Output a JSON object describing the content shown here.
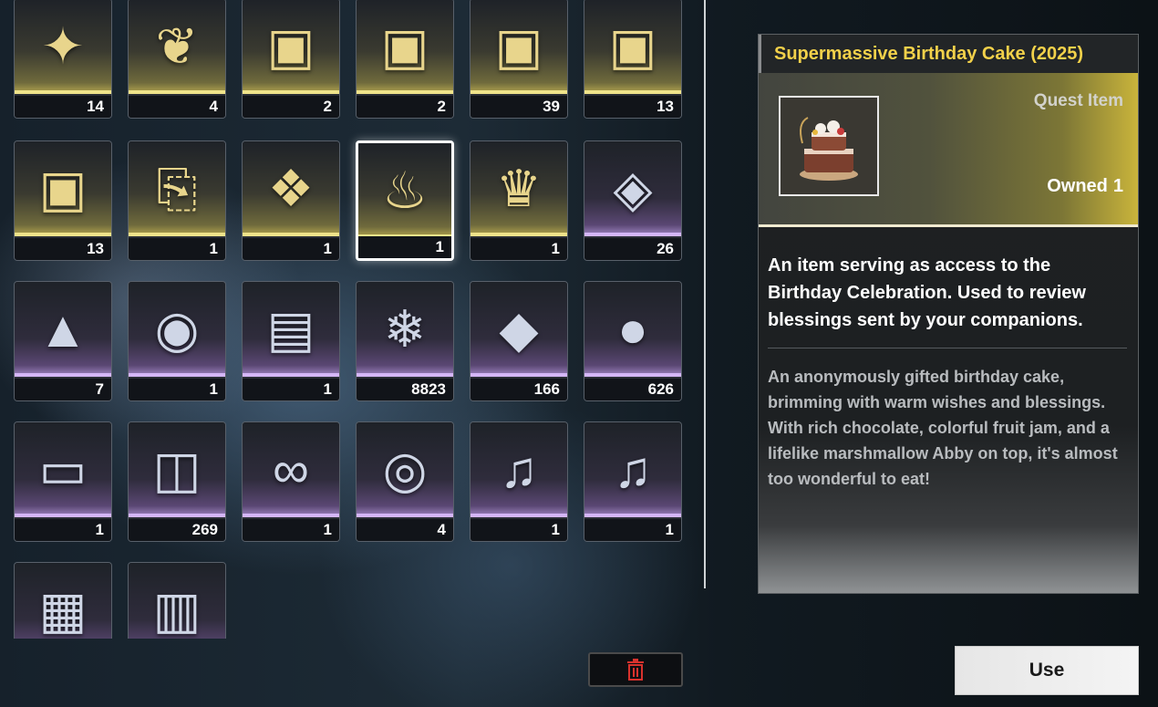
{
  "inventory": {
    "items": [
      {
        "icon": "golden-orb-icon",
        "count": "14",
        "rarity": "gold"
      },
      {
        "icon": "iridescent-coral-icon",
        "count": "4",
        "rarity": "gold"
      },
      {
        "icon": "silver-supply-box-icon",
        "count": "2",
        "rarity": "gold"
      },
      {
        "icon": "silver-supply-box-icon",
        "count": "2",
        "rarity": "gold"
      },
      {
        "icon": "gold-supply-box-icon",
        "count": "39",
        "rarity": "gold"
      },
      {
        "icon": "red-supply-box-icon",
        "count": "13",
        "rarity": "gold"
      },
      {
        "icon": "red-supply-box-icon",
        "count": "13",
        "rarity": "gold"
      },
      {
        "icon": "ticket-device-icon",
        "count": "1",
        "rarity": "gold"
      },
      {
        "icon": "crystal-feather-icon",
        "count": "1",
        "rarity": "gold"
      },
      {
        "icon": "birthday-cake-icon",
        "count": "1",
        "rarity": "gold",
        "selected": true
      },
      {
        "icon": "golden-crown-icon",
        "count": "1",
        "rarity": "gold"
      },
      {
        "icon": "glowing-cube-icon",
        "count": "26",
        "rarity": "purple"
      },
      {
        "icon": "triangle-case-icon",
        "count": "7",
        "rarity": "purple"
      },
      {
        "icon": "medal-keychain-icon",
        "count": "1",
        "rarity": "purple"
      },
      {
        "icon": "card-frame-icon",
        "count": "1",
        "rarity": "purple"
      },
      {
        "icon": "ice-coral-icon",
        "count": "8823",
        "rarity": "purple"
      },
      {
        "icon": "bronze-shard-icon",
        "count": "166",
        "rarity": "purple"
      },
      {
        "icon": "gold-coin-icon",
        "count": "626",
        "rarity": "purple"
      },
      {
        "icon": "metal-chest-icon",
        "count": "1",
        "rarity": "purple"
      },
      {
        "icon": "purple-crate-icon",
        "count": "269",
        "rarity": "purple"
      },
      {
        "icon": "infinity-charm-icon",
        "count": "1",
        "rarity": "purple"
      },
      {
        "icon": "camera-icon",
        "count": "4",
        "rarity": "purple"
      },
      {
        "icon": "music-box-icon",
        "count": "1",
        "rarity": "purple"
      },
      {
        "icon": "music-box-icon",
        "count": "1",
        "rarity": "purple"
      },
      {
        "icon": "photo-cards-icon",
        "count": "",
        "rarity": "purple"
      },
      {
        "icon": "device-case-icon",
        "count": "",
        "rarity": "purple"
      }
    ]
  },
  "detail": {
    "title": "Supermassive Birthday Cake (2025)",
    "type": "Quest Item",
    "owned_label": "Owned",
    "owned_value": "1",
    "description": "An item serving as access to the Birthday Celebration. Used to review blessings sent by your companions.",
    "lore": "An anonymously gifted birthday cake, brimming with warm wishes and blessings. With rich chocolate, colorful fruit jam, and a lifelike marshmallow Abby on top, it's almost too wonderful to eat!"
  },
  "actions": {
    "use_label": "Use",
    "trash_icon": "trash-icon"
  },
  "colors": {
    "title_gold": "#f2d14a",
    "rarity_gold": "#efe38a",
    "rarity_purple": "#d4b6f7",
    "trash_red": "#d8322d"
  }
}
